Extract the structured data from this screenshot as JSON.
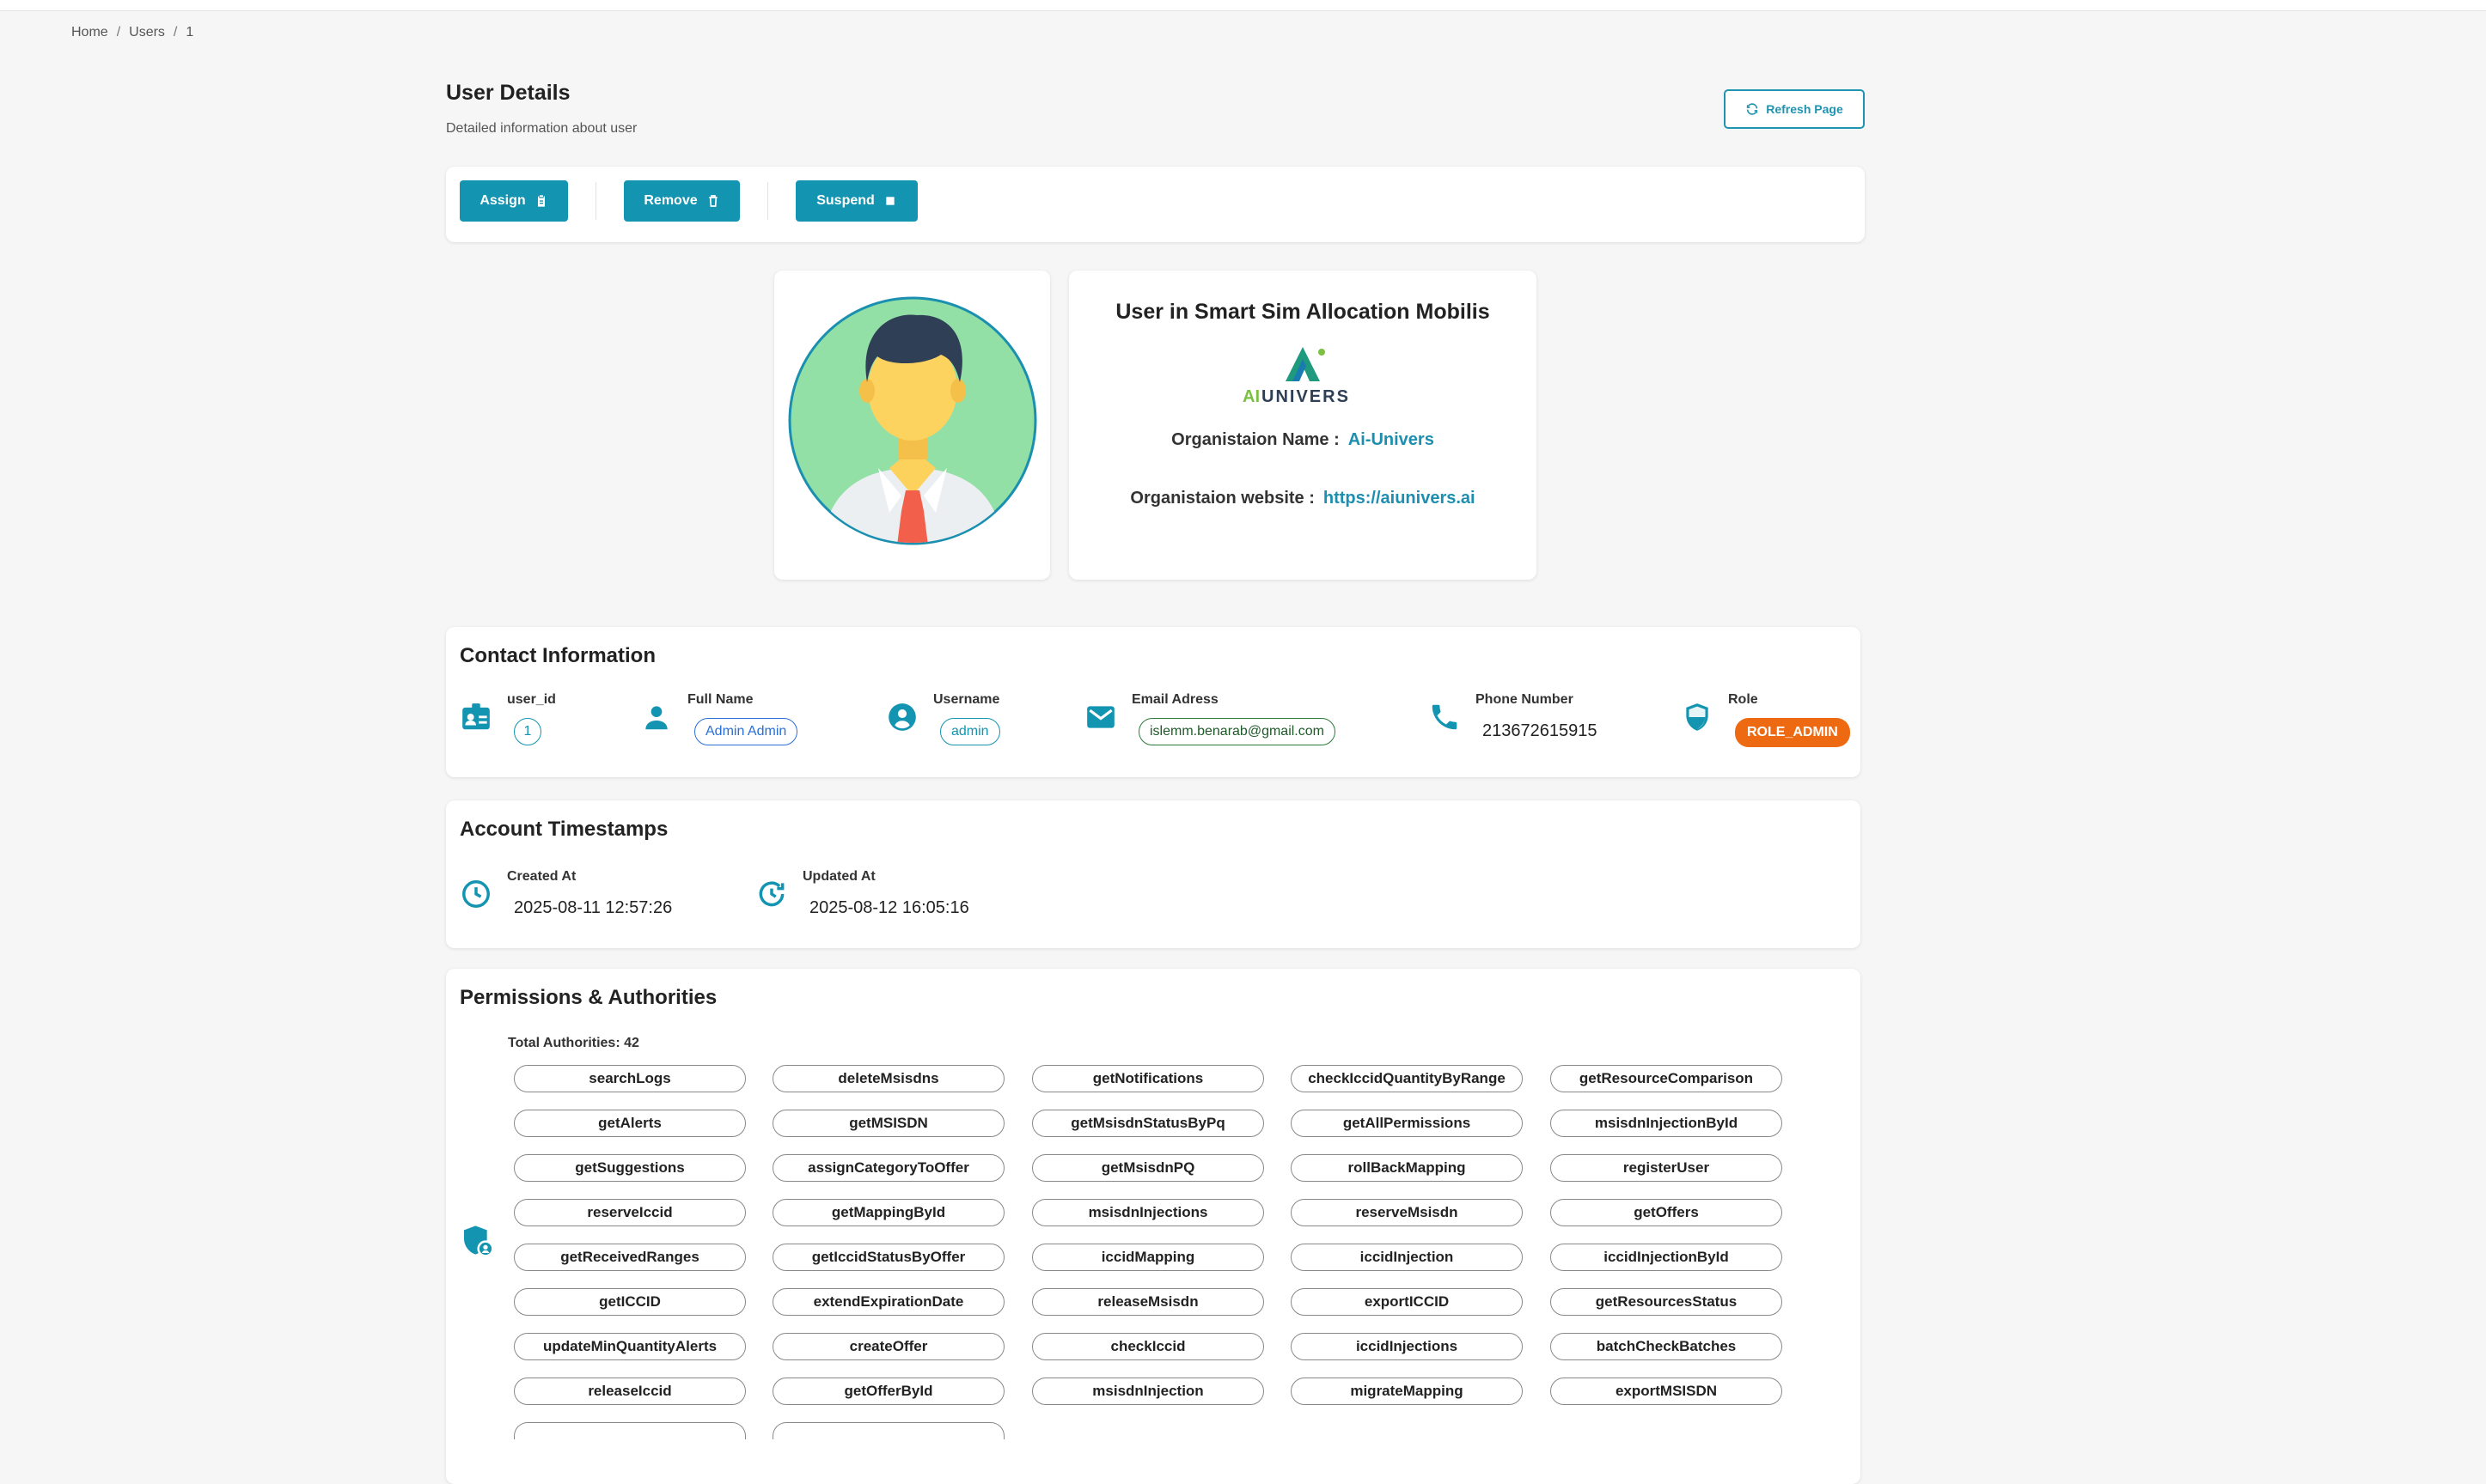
{
  "breadcrumb": [
    "Home",
    "Users",
    "1"
  ],
  "header": {
    "title": "User Details",
    "subtitle": "Detailed information about user",
    "refresh_label": "Refresh Page"
  },
  "toolbar": {
    "assign_label": "Assign",
    "remove_label": "Remove",
    "suspend_label": "Suspend"
  },
  "organization": {
    "heading": "User in Smart Sim Allocation Mobilis",
    "logo_text_ai": "AI",
    "logo_text_univers": "UNIVERS",
    "name_label": "Organistaion Name :",
    "name_value": "Ai-Univers",
    "website_label": "Organistaion website :",
    "website_value": "https://aiunivers.ai"
  },
  "contact": {
    "title": "Contact Information",
    "user_id_label": "user_id",
    "user_id": "1",
    "full_name_label": "Full Name",
    "full_name": "Admin Admin",
    "username_label": "Username",
    "username": "admin",
    "email_label": "Email Adress",
    "email": "islemm.benarab@gmail.com",
    "phone_label": "Phone Number",
    "phone": "213672615915",
    "role_label": "Role",
    "role": "ROLE_ADMIN"
  },
  "timestamps": {
    "title": "Account Timestamps",
    "created_label": "Created At",
    "created": "2025-08-11 12:57:26",
    "updated_label": "Updated At",
    "updated": "2025-08-12 16:05:16"
  },
  "permissions": {
    "title": "Permissions & Authorities",
    "total": "Total Authorities: 42",
    "items": [
      "searchLogs",
      "deleteMsisdns",
      "getNotifications",
      "checkIccidQuantityByRange",
      "getResourceComparison",
      "getAlerts",
      "getMSISDN",
      "getMsisdnStatusByPq",
      "getAllPermissions",
      "msisdnInjectionById",
      "getSuggestions",
      "assignCategoryToOffer",
      "getMsisdnPQ",
      "rollBackMapping",
      "registerUser",
      "reserveIccid",
      "getMappingById",
      "msisdnInjections",
      "reserveMsisdn",
      "getOffers",
      "getReceivedRanges",
      "getIccidStatusByOffer",
      "iccidMapping",
      "iccidInjection",
      "iccidInjectionById",
      "getICCID",
      "extendExpirationDate",
      "releaseMsisdn",
      "exportICCID",
      "getResourcesStatus",
      "updateMinQuantityAlerts",
      "createOffer",
      "checkIccid",
      "iccidInjections",
      "batchCheckBatches",
      "releaseIccid",
      "getOfferById",
      "msisdnInjection",
      "migrateMapping",
      "exportMSISDN"
    ]
  },
  "colors": {
    "accent": "#1394b1",
    "role_badge": "#ee6a12",
    "link": "#1c8fb0"
  }
}
